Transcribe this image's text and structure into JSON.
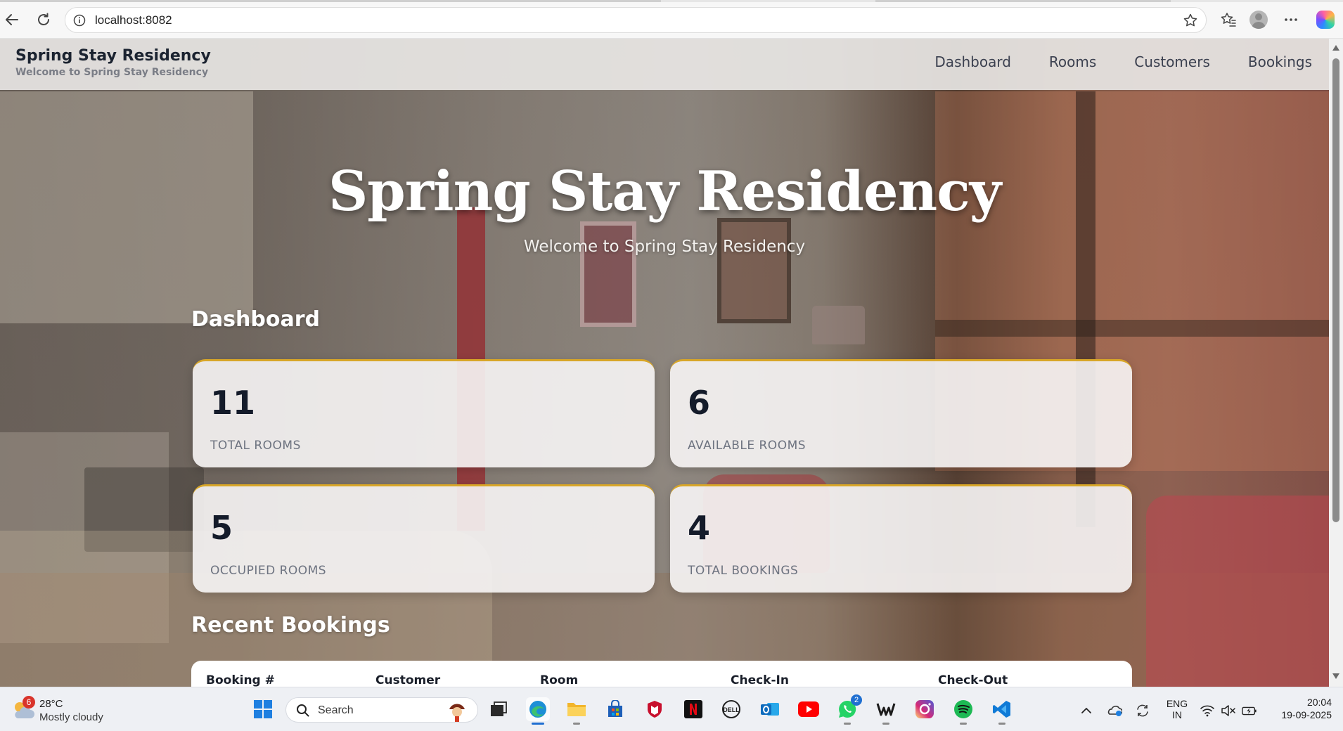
{
  "browser": {
    "url": "localhost:8082"
  },
  "site": {
    "brand_title": "Spring Stay Residency",
    "brand_subtitle": "Welcome to Spring Stay Residency",
    "nav": [
      "Dashboard",
      "Rooms",
      "Customers",
      "Bookings"
    ]
  },
  "hero": {
    "title": "Spring Stay Residency",
    "subtitle": "Welcome to Spring Stay Residency"
  },
  "dashboard": {
    "heading": "Dashboard",
    "stats": [
      {
        "value": "11",
        "label": "TOTAL ROOMS"
      },
      {
        "value": "6",
        "label": "AVAILABLE ROOMS"
      },
      {
        "value": "5",
        "label": "OCCUPIED ROOMS"
      },
      {
        "value": "4",
        "label": "TOTAL BOOKINGS"
      }
    ],
    "accent_color": "#d8a628"
  },
  "recent_bookings": {
    "heading": "Recent Bookings",
    "columns": [
      "Booking #",
      "Customer",
      "Room",
      "Check-In",
      "Check-Out"
    ]
  },
  "taskbar": {
    "weather": {
      "badge": "6",
      "temp": "28°C",
      "desc": "Mostly cloudy"
    },
    "search_placeholder": "Search",
    "whatsapp_badge": "2",
    "lang_line1": "ENG",
    "lang_line2": "IN",
    "time": "20:04",
    "date": "19-09-2025"
  }
}
